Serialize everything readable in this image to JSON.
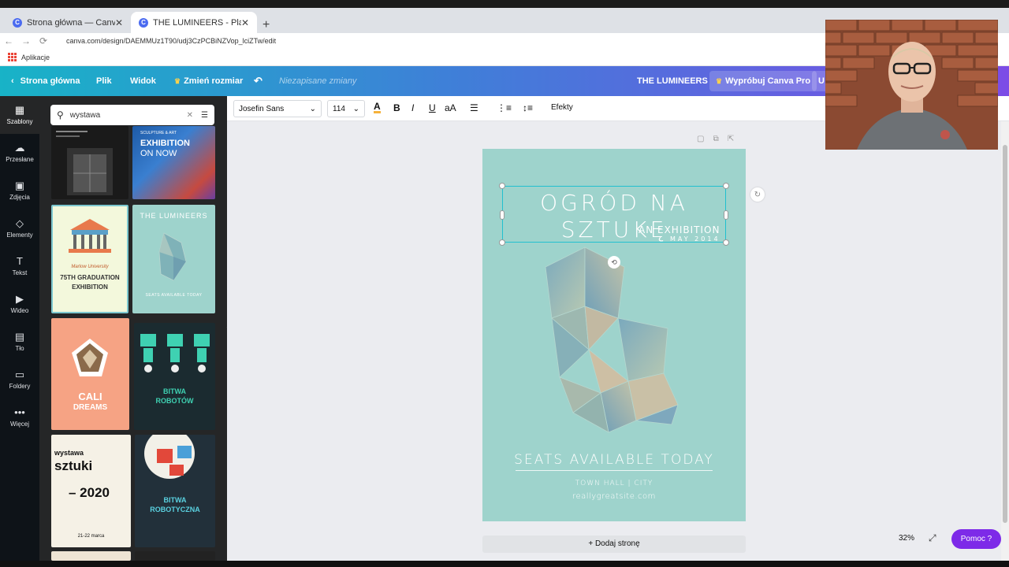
{
  "browser": {
    "tabs": [
      {
        "label": "Strona główna — Canva",
        "favicon": "C",
        "active": false
      },
      {
        "label": "THE LUMINEERS - Plakat",
        "favicon": "C",
        "active": true
      }
    ],
    "new_tab": "+",
    "close_glyph": "✕",
    "url": "canva.com/design/DAEMMUz1T90/udj3CzPCBiNZVop_lciZTw/edit",
    "bookmarks_label": "Aplikacje"
  },
  "header": {
    "back_label": "Strona główna",
    "file_label": "Plik",
    "view_label": "Widok",
    "resize_label": "Zmień rozmiar",
    "unsaved_label": "Niezapisane zmiany",
    "design_title": "THE LUMINEERS",
    "try_pro_label": "Wypróbuj Canva Pro",
    "share_partial": "U"
  },
  "rail": {
    "items": [
      {
        "label": "Szablony",
        "icon": "templates-icon"
      },
      {
        "label": "Przesłane",
        "icon": "upload-icon"
      },
      {
        "label": "Zdjęcia",
        "icon": "photos-icon"
      },
      {
        "label": "Elementy",
        "icon": "elements-icon"
      },
      {
        "label": "Tekst",
        "icon": "text-icon"
      },
      {
        "label": "Wideo",
        "icon": "video-icon"
      },
      {
        "label": "Tło",
        "icon": "background-icon"
      },
      {
        "label": "Foldery",
        "icon": "folder-icon"
      },
      {
        "label": "Więcej",
        "icon": "more-icon"
      }
    ]
  },
  "panel": {
    "search_value": "wystawa",
    "templates": {
      "t2_line1": "SCULPTURE & ART",
      "t2_line2": "EXHIBITION",
      "t2_line3": "ON NOW",
      "t3_line1": "Marlow University",
      "t3_line2": "75TH GRADUATION",
      "t3_line3": "EXHIBITION",
      "t4_title": "THE LUMINEERS",
      "t4_bottom": "SEATS AVAILABLE TODAY",
      "t5_line1": "CALI",
      "t5_line2": "DREAMS",
      "t6_line1": "BITWA",
      "t6_line2": "ROBOTÓW",
      "t7_line1": "wystawa",
      "t7_line2": "sztuki",
      "t7_line3": "– 2020",
      "t7_date": "21-22 marca",
      "t8_line1": "BITWA",
      "t8_line2": "ROBOTYCZNA"
    }
  },
  "toolbar": {
    "font_family": "Josefin Sans",
    "font_size": "114",
    "bold": "B",
    "italic": "I",
    "underline": "U",
    "case": "aA",
    "effects_label": "Efekty"
  },
  "canvas": {
    "title_line1": "OGRÓD NA",
    "title_line2": "SZTUKĘ",
    "overlap_line1": "AN EXHIBITION",
    "overlap_line2": "MAY 2014",
    "seats": "SEATS AVAILABLE TODAY",
    "venue": "TOWN HALL | CITY",
    "site": "reallygreatsite.com",
    "background_color": "#9ed3cc",
    "add_page_label": "+ Dodaj stronę"
  },
  "footer": {
    "zoom": "32%",
    "help_label": "Pomoc ?"
  }
}
